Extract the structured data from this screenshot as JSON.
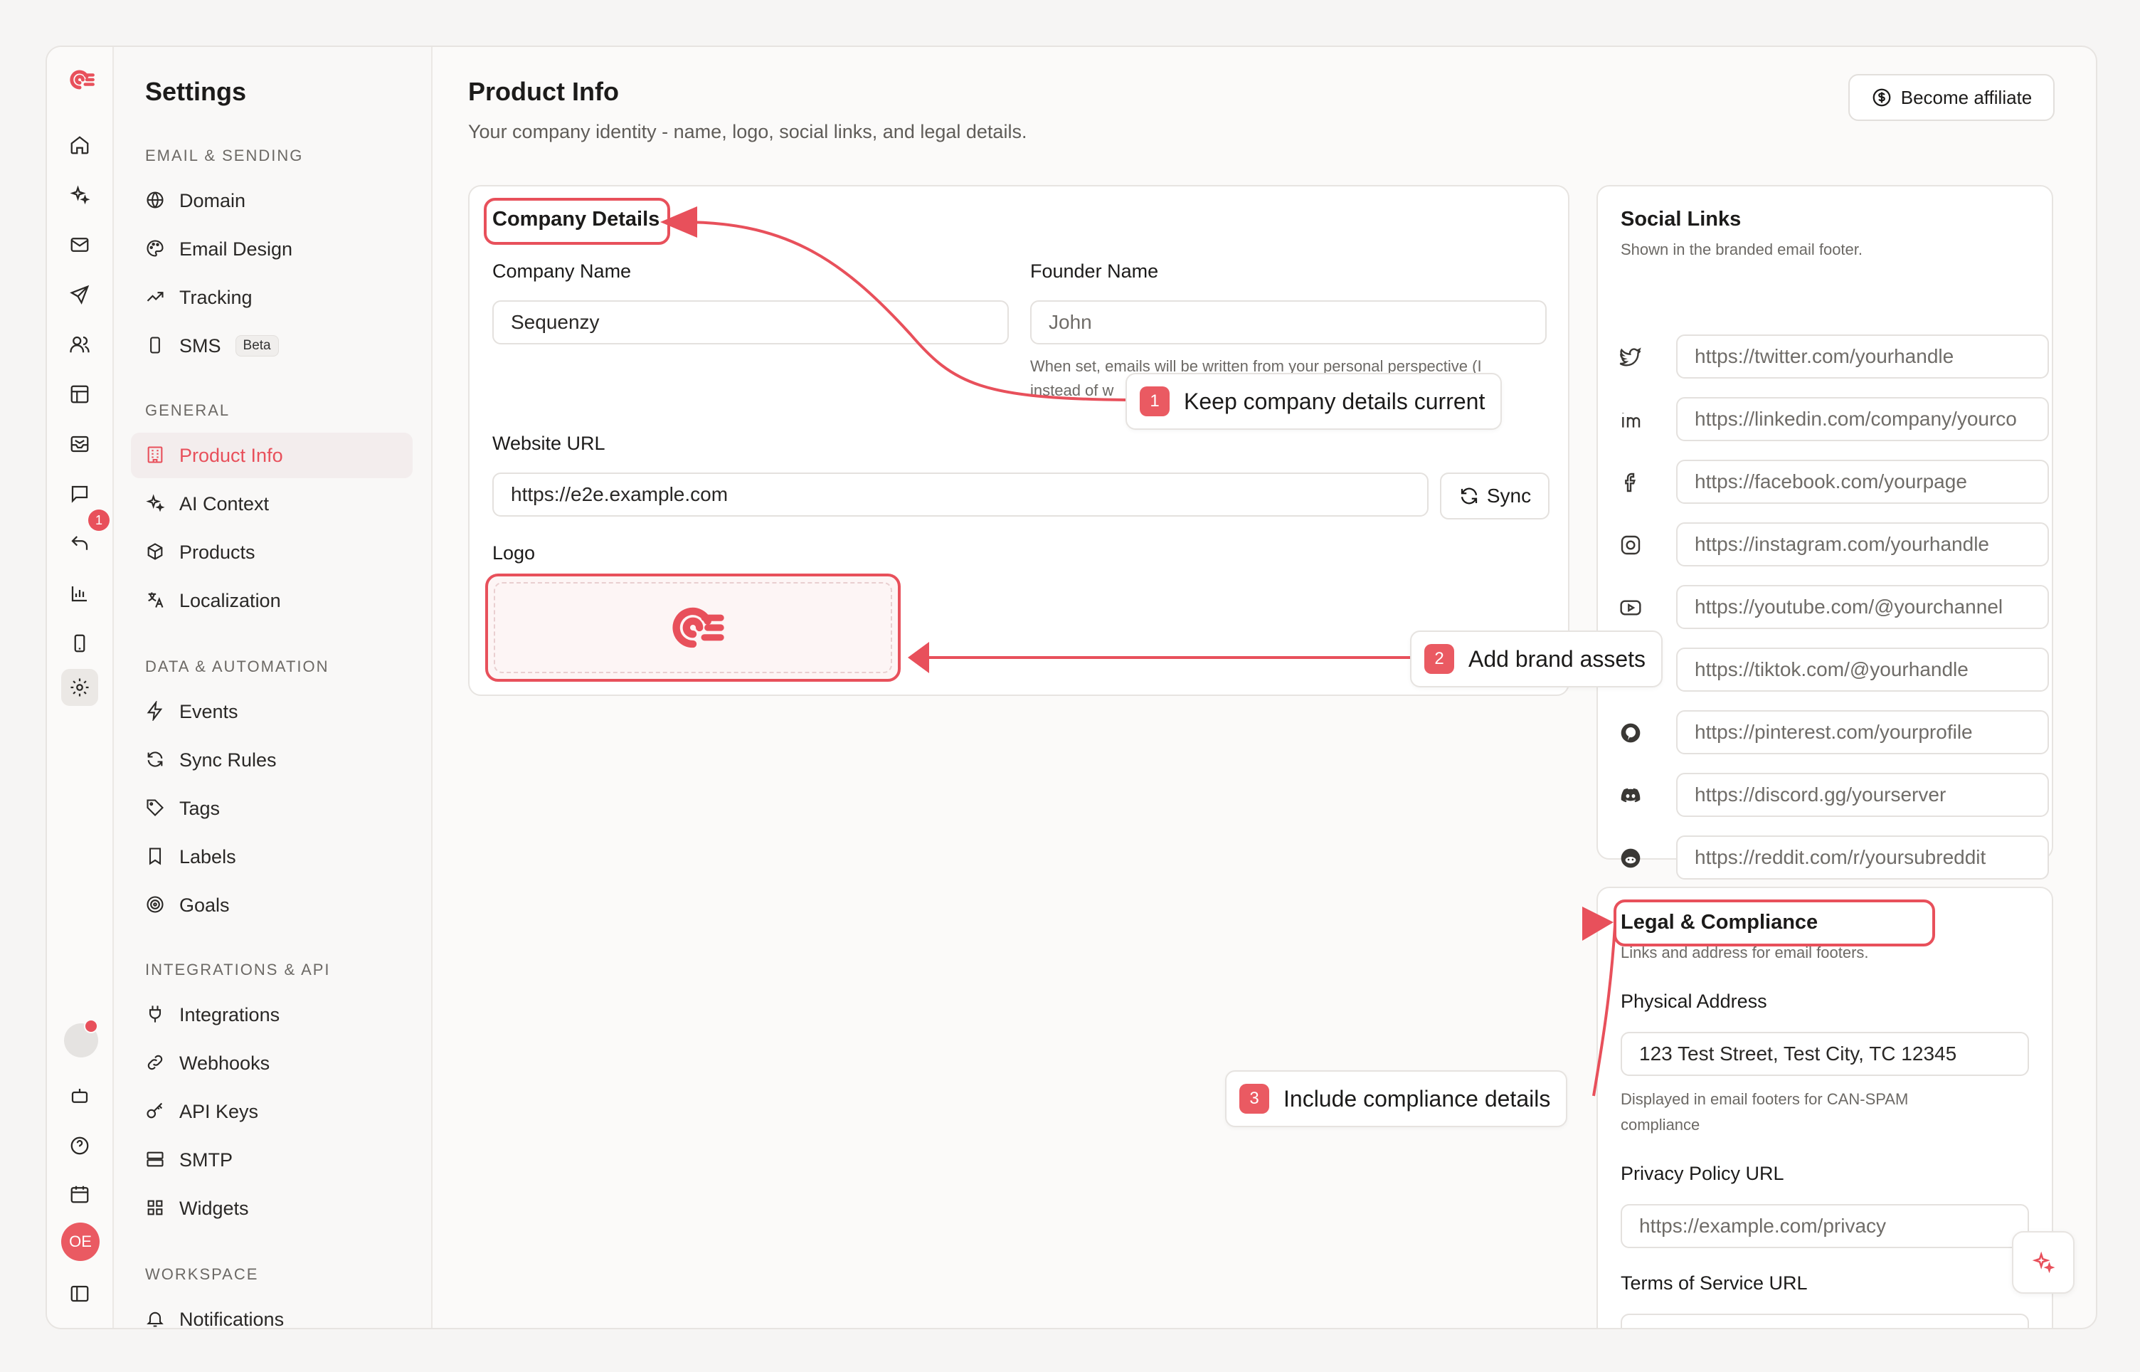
{
  "colors": {
    "accent": "#e8505b",
    "background": "#fbfaf9"
  },
  "rail": {
    "icons": [
      "logo-icon",
      "home-icon",
      "sparkles-icon",
      "mail-icon",
      "send-icon",
      "users-icon",
      "layout-icon",
      "inbox-icon",
      "chat-icon",
      "reply-icon",
      "chart-icon",
      "mobile-icon",
      "gear-icon"
    ],
    "notification_count": "1",
    "avatar_initials": "OE"
  },
  "nav": {
    "title": "Settings",
    "sections": [
      {
        "label": "EMAIL & SENDING",
        "items": [
          "Domain",
          "Email Design",
          "Tracking",
          "SMS"
        ]
      },
      {
        "label": "GENERAL",
        "items": [
          "Product Info",
          "AI Context",
          "Products",
          "Localization"
        ]
      },
      {
        "label": "DATA & AUTOMATION",
        "items": [
          "Events",
          "Sync Rules",
          "Tags",
          "Labels",
          "Goals"
        ]
      },
      {
        "label": "INTEGRATIONS & API",
        "items": [
          "Integrations",
          "Webhooks",
          "API Keys",
          "SMTP",
          "Widgets"
        ]
      },
      {
        "label": "WORKSPACE",
        "items": [
          "Notifications"
        ]
      }
    ],
    "sms_badge": "Beta",
    "active_item": "Product Info"
  },
  "page": {
    "title": "Product Info",
    "subtitle": "Your company identity - name, logo, social links, and legal details.",
    "affiliate_button": "Become affiliate"
  },
  "company": {
    "title": "Company Details",
    "company_name_label": "Company Name",
    "company_name_value": "Sequenzy",
    "founder_name_label": "Founder Name",
    "founder_name_placeholder": "John",
    "founder_hint_1": "When set, emails will be written from your personal perspective (I",
    "founder_hint_2": "instead of w",
    "website_label": "Website URL",
    "website_value": "https://e2e.example.com",
    "sync_button": "Sync",
    "logo_label": "Logo"
  },
  "social": {
    "title": "Social Links",
    "subtitle": "Shown in the branded email footer.",
    "links": [
      {
        "icon": "twitter-icon",
        "placeholder": "https://twitter.com/yourhandle"
      },
      {
        "icon": "linkedin-icon",
        "placeholder": "https://linkedin.com/company/yourco"
      },
      {
        "icon": "facebook-icon",
        "placeholder": "https://facebook.com/yourpage"
      },
      {
        "icon": "instagram-icon",
        "placeholder": "https://instagram.com/yourhandle"
      },
      {
        "icon": "youtube-icon",
        "placeholder": "https://youtube.com/@yourchannel"
      },
      {
        "icon": "tiktok-icon",
        "placeholder": "https://tiktok.com/@yourhandle"
      },
      {
        "icon": "pinterest-icon",
        "placeholder": "https://pinterest.com/yourprofile"
      },
      {
        "icon": "discord-icon",
        "placeholder": "https://discord.gg/yourserver"
      },
      {
        "icon": "reddit-icon",
        "placeholder": "https://reddit.com/r/yoursubreddit"
      }
    ]
  },
  "legal": {
    "title": "Legal & Compliance",
    "subtitle": "Links and address for email footers.",
    "address_label": "Physical Address",
    "address_value": "123 Test Street, Test City, TC 12345",
    "address_hint_1": "Displayed in email footers for CAN-SPAM",
    "address_hint_2": "compliance",
    "privacy_label": "Privacy Policy URL",
    "privacy_placeholder": "https://example.com/privacy",
    "terms_label": "Terms of Service URL"
  },
  "callouts": [
    {
      "num": "1",
      "text": "Keep company details current"
    },
    {
      "num": "2",
      "text": "Add brand assets"
    },
    {
      "num": "3",
      "text": "Include compliance details"
    }
  ]
}
